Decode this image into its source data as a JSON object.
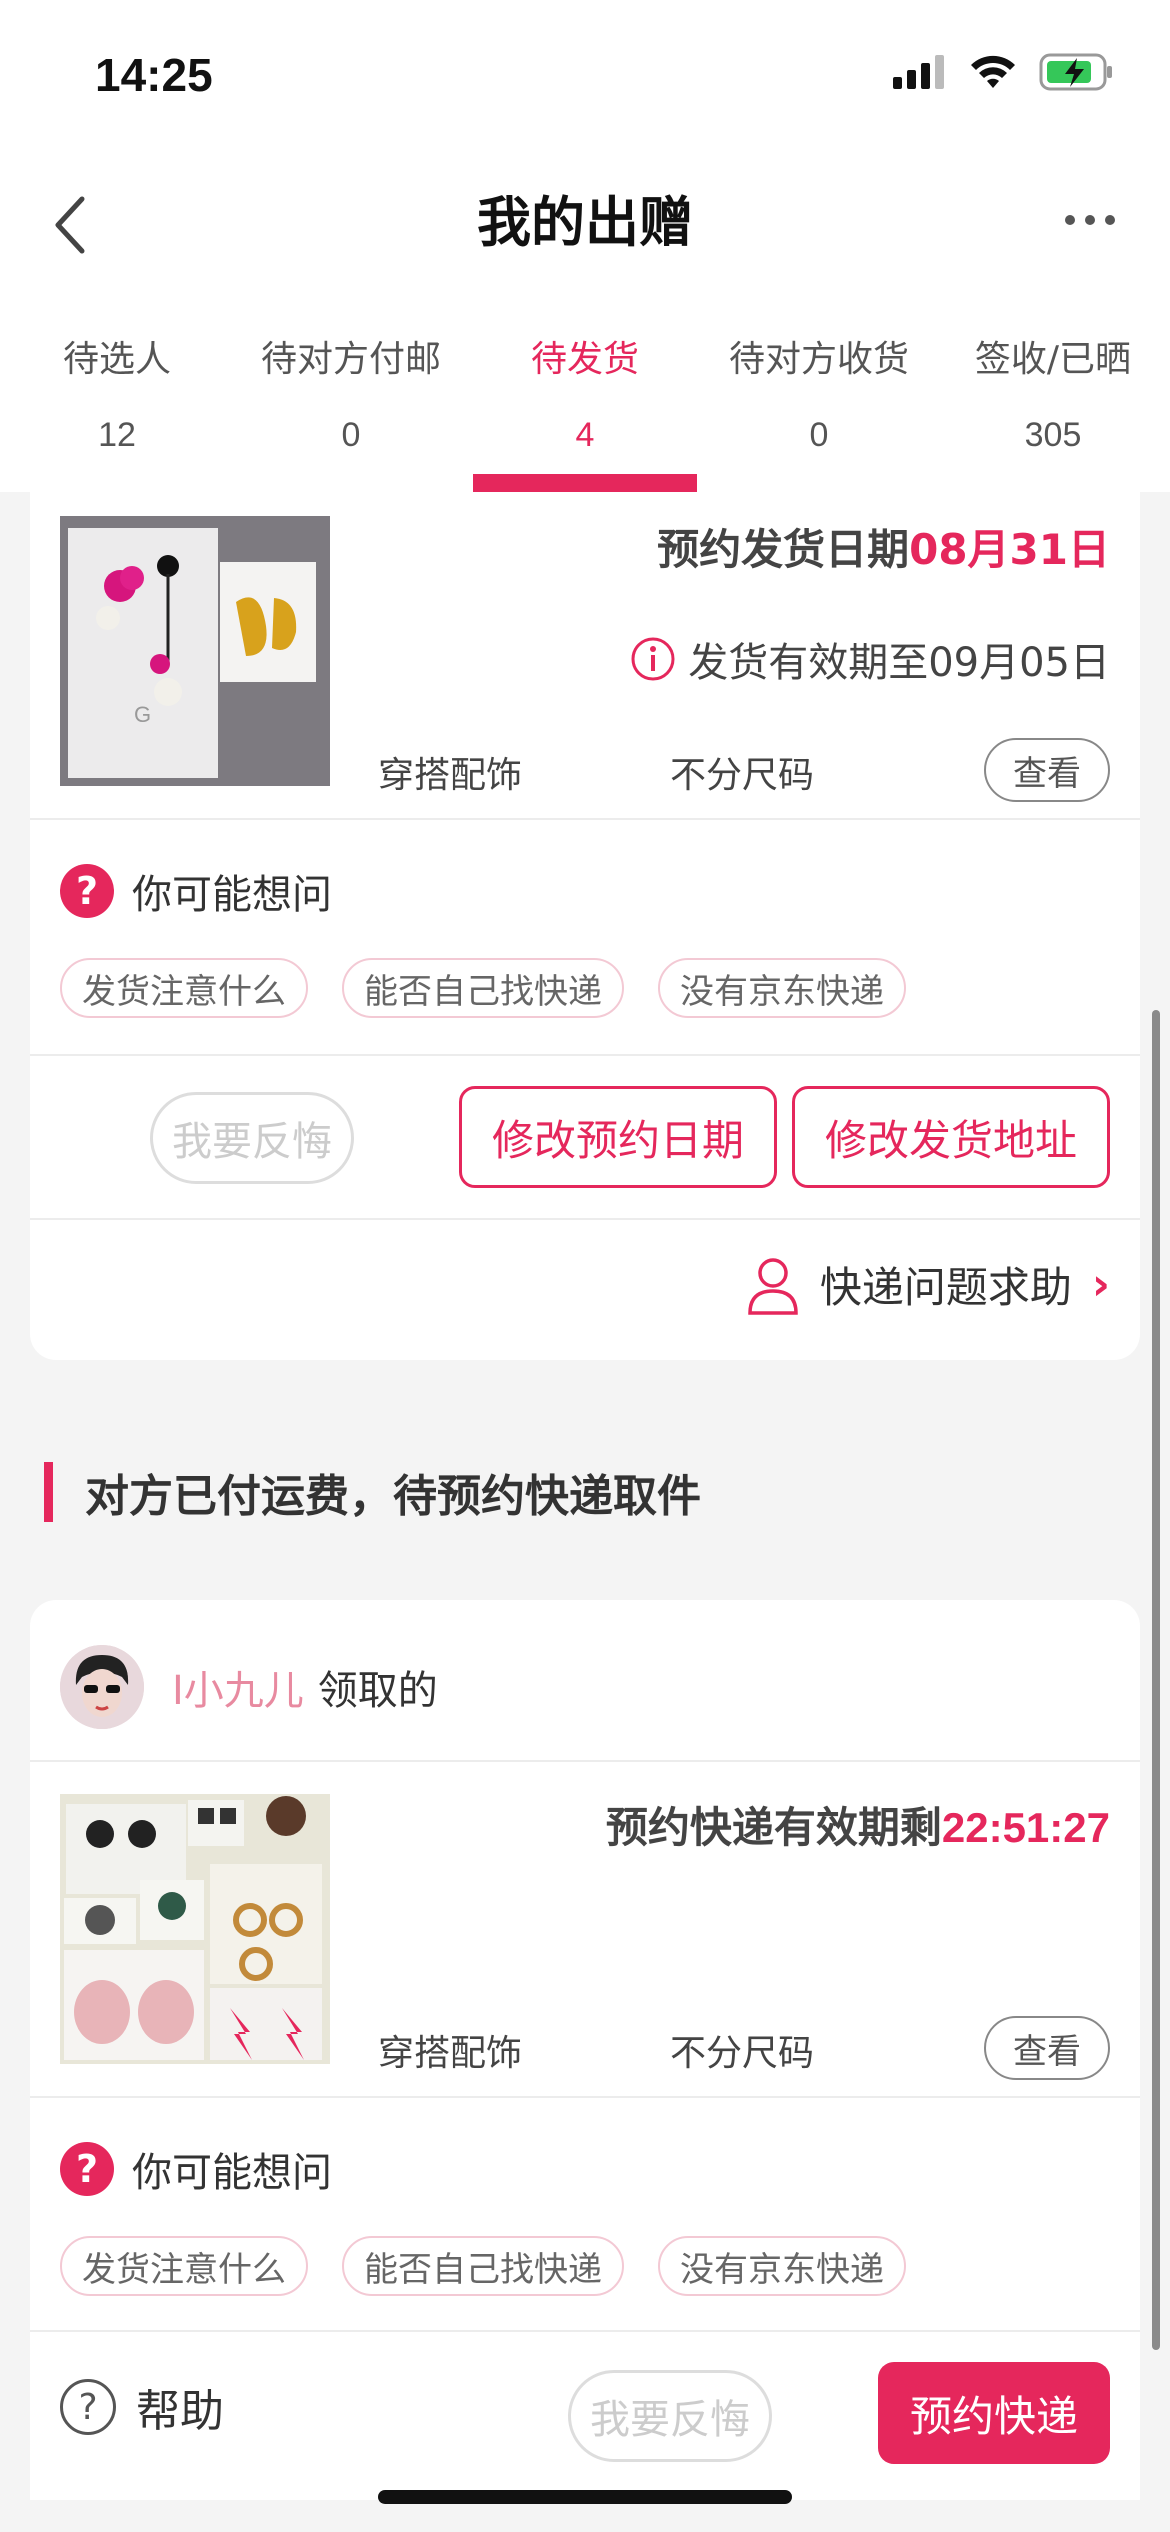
{
  "status_bar": {
    "time": "14:25"
  },
  "nav": {
    "title": "我的出赠"
  },
  "tabs": [
    {
      "label": "待选人",
      "count": "12"
    },
    {
      "label": "待对方付邮",
      "count": "0"
    },
    {
      "label": "待发货",
      "count": "4"
    },
    {
      "label": "待对方收货",
      "count": "0"
    },
    {
      "label": "签收/已晒",
      "count": "305"
    }
  ],
  "active_tab": "待发货",
  "card1": {
    "ship_date_label": "预约发货日期",
    "ship_date_value": "08月31日",
    "validity": "发货有效期至09月05日",
    "category": "穿搭配饰",
    "size": "不分尺码",
    "view_label": "查看",
    "faq_title": "你可能想问",
    "faq_chips": [
      "发货注意什么",
      "能否自己找快递",
      "没有京东快递"
    ],
    "regret_label": "我要反悔",
    "modify_date_label": "修改预约日期",
    "modify_address_label": "修改发货地址",
    "courier_help_label": "快递问题求助"
  },
  "section": {
    "heading": "对方已付运费，待预约快递取件"
  },
  "card2": {
    "receiver_name": "I小九儿",
    "receiver_suffix": "领取的",
    "countdown_label": "预约快递有效期剩",
    "countdown_value": "22:51:27",
    "category": "穿搭配饰",
    "size": "不分尺码",
    "view_label": "查看",
    "faq_title": "你可能想问",
    "faq_chips": [
      "发货注意什么",
      "能否自己找快递",
      "没有京东快递"
    ]
  },
  "bottom_bar": {
    "help_label": "帮助",
    "regret_label": "我要反悔",
    "book_label": "预约快递"
  },
  "colors": {
    "accent": "#e5275c",
    "background": "#f4f4f4"
  },
  "icons": [
    "back-arrow-icon",
    "more-icon",
    "signal-icon",
    "wifi-icon",
    "battery-icon",
    "info-icon",
    "question-icon",
    "person-icon",
    "chevron-right-icon",
    "help-icon"
  ]
}
